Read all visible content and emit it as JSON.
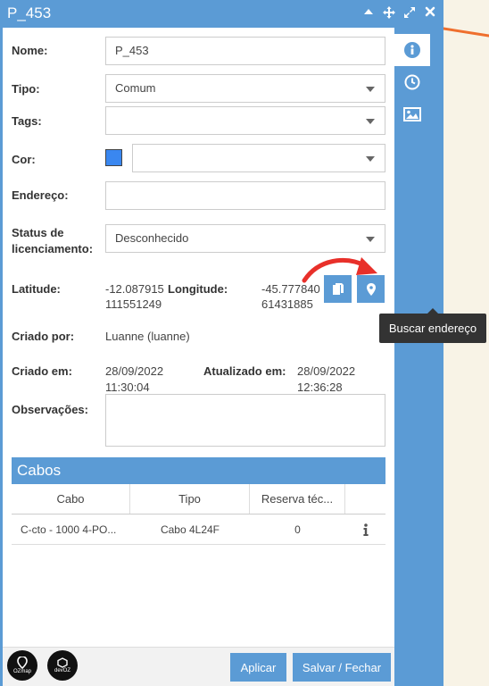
{
  "window": {
    "title": "P_453"
  },
  "form": {
    "nome_label": "Nome:",
    "nome_value": "P_453",
    "tipo_label": "Tipo:",
    "tipo_value": "Comum",
    "tags_label": "Tags:",
    "tags_value": "",
    "cor_label": "Cor:",
    "cor_color": "#3a87f0",
    "endereco_label": "Endereço:",
    "endereco_value": "",
    "status_label_1": "Status de",
    "status_label_2": "licenciamento:",
    "status_value": "Desconhecido",
    "latitude_label": "Latitude:",
    "latitude_line1": "-12.087915",
    "latitude_line2": "111551249",
    "longitude_label": "Longitude:",
    "longitude_line1": "-45.777840",
    "longitude_line2": "61431885",
    "criado_por_label": "Criado por:",
    "criado_por_value": "Luanne (luanne)",
    "criado_em_label": "Criado em:",
    "criado_em_date": "28/09/2022",
    "criado_em_time": "11:30:04",
    "atualizado_em_label": "Atualizado em:",
    "atualizado_em_date": "28/09/2022",
    "atualizado_em_time": "12:36:28",
    "observacoes_label": "Observações:"
  },
  "tooltip": "Buscar endereço",
  "cabos": {
    "title": "Cabos",
    "columns": [
      "Cabo",
      "Tipo",
      "Reserva téc..."
    ],
    "rows": [
      {
        "cabo": "C-cto - 1000 4-PO...",
        "tipo": "Cabo 4L24F",
        "reserva": "0"
      }
    ]
  },
  "footer": {
    "aplicar": "Aplicar",
    "salvar": "Salvar / Fechar",
    "logo1": "OZmap",
    "logo2": "devOZ"
  },
  "colors": {
    "accent": "#5b9bd5",
    "arrow": "#e8302a"
  }
}
